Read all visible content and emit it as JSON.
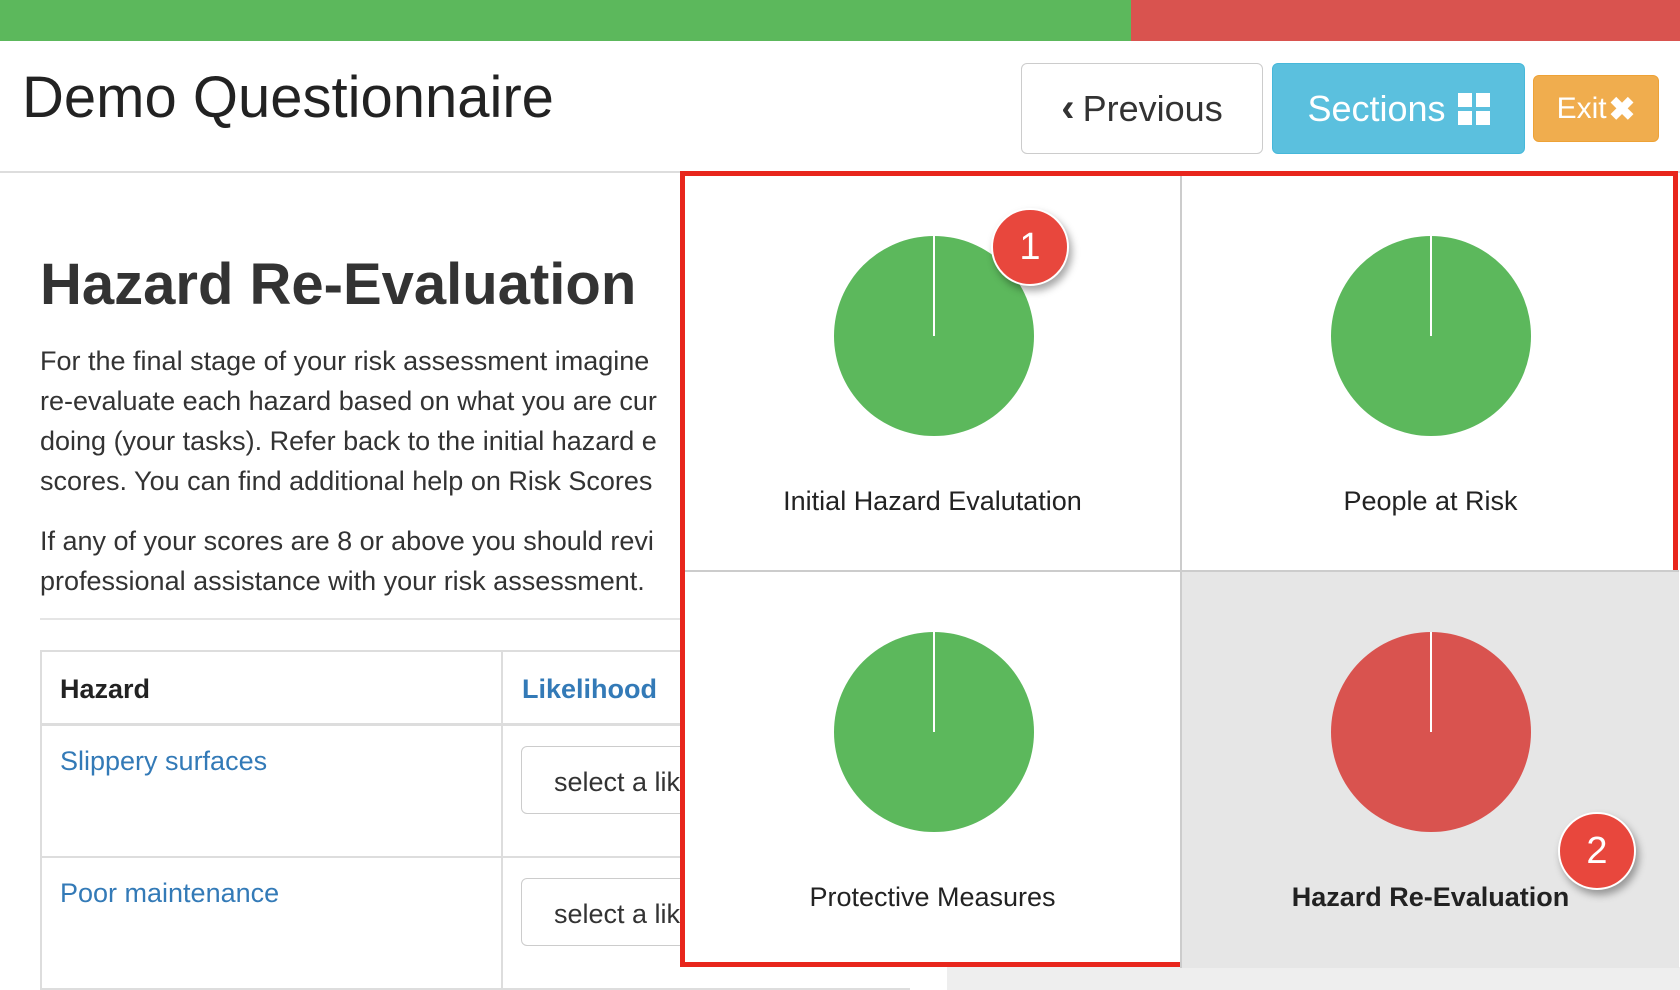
{
  "progress": {
    "completed_fraction": 0.673,
    "completed_color": "#5cb85c",
    "remaining_color": "#d9534f"
  },
  "header": {
    "title": "Demo Questionnaire",
    "previous_label": "Previous",
    "sections_label": "Sections",
    "exit_label": "Exit",
    "previous_icon": "chevron-left-icon",
    "sections_icon": "grid-icon",
    "exit_icon": "close-icon"
  },
  "section": {
    "title": "Hazard Re-Evaluation",
    "paragraph1_lines": [
      "For the final stage of your risk assessment imagine",
      "re-evaluate each hazard based on what you are cur",
      "doing (your tasks). Refer back to the initial hazard e",
      "scores. You can find additional help on Risk Scores"
    ],
    "paragraph2_lines": [
      "If any of your scores are 8 or above you should revi",
      "professional assistance with your risk assessment."
    ]
  },
  "table": {
    "headers": {
      "hazard": "Hazard",
      "likelihood": "Likelihood"
    },
    "rows": [
      {
        "hazard": "Slippery surfaces",
        "likelihood_placeholder": "select a lik"
      },
      {
        "hazard": "Poor maintenance",
        "likelihood_placeholder": "select a lik"
      }
    ]
  },
  "sections_menu": {
    "tiles": [
      {
        "label": "Initial Hazard Evalutation",
        "status": "complete",
        "color": "#5cb85c"
      },
      {
        "label": "People at Risk",
        "status": "complete",
        "color": "#5cb85c"
      },
      {
        "label": "Protective Measures",
        "status": "complete",
        "color": "#5cb85c"
      },
      {
        "label": "Hazard Re-Evaluation",
        "status": "current",
        "color": "#d9534f"
      }
    ],
    "badges": [
      "1",
      "2"
    ]
  }
}
